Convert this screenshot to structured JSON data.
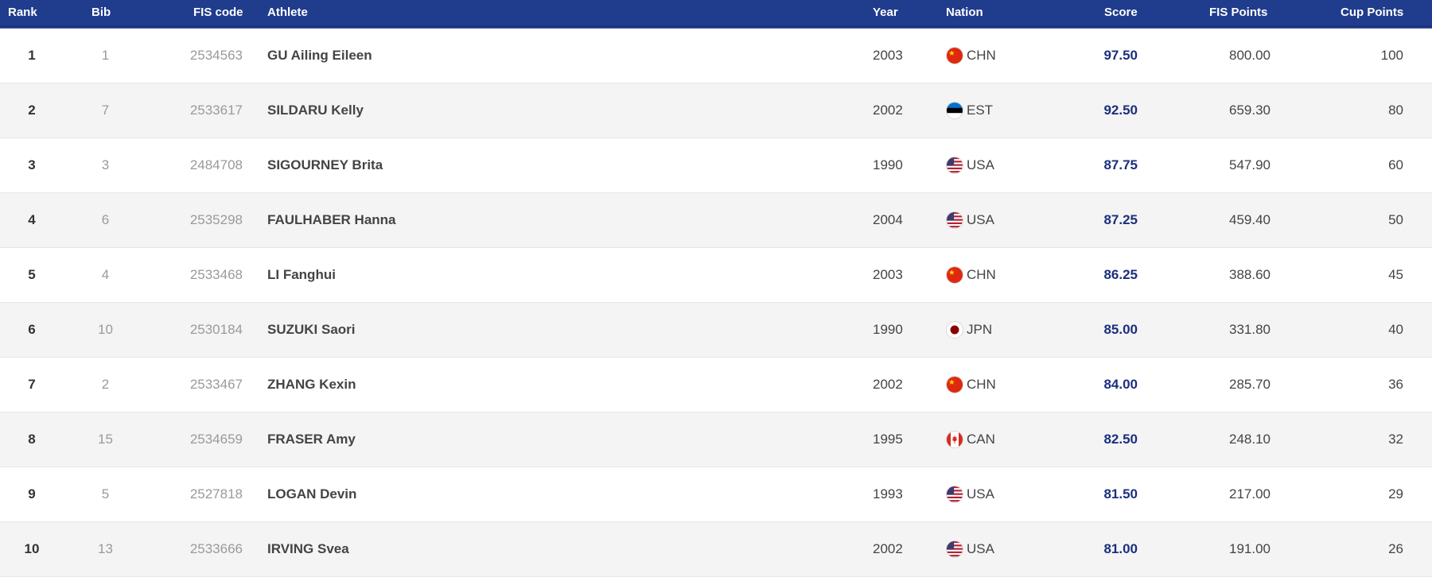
{
  "columns": {
    "rank": "Rank",
    "bib": "Bib",
    "fis_code": "FIS code",
    "athlete": "Athlete",
    "year": "Year",
    "nation": "Nation",
    "score": "Score",
    "fis_points": "FIS Points",
    "cup_points": "Cup Points"
  },
  "rows": [
    {
      "rank": "1",
      "bib": "1",
      "fis_code": "2534563",
      "athlete": "GU Ailing Eileen",
      "year": "2003",
      "nation": "CHN",
      "flag_icon": "china-flag-icon",
      "score": "97.50",
      "fis_points": "800.00",
      "cup_points": "100"
    },
    {
      "rank": "2",
      "bib": "7",
      "fis_code": "2533617",
      "athlete": "SILDARU Kelly",
      "year": "2002",
      "nation": "EST",
      "flag_icon": "estonia-flag-icon",
      "score": "92.50",
      "fis_points": "659.30",
      "cup_points": "80"
    },
    {
      "rank": "3",
      "bib": "3",
      "fis_code": "2484708",
      "athlete": "SIGOURNEY Brita",
      "year": "1990",
      "nation": "USA",
      "flag_icon": "usa-flag-icon",
      "score": "87.75",
      "fis_points": "547.90",
      "cup_points": "60"
    },
    {
      "rank": "4",
      "bib": "6",
      "fis_code": "2535298",
      "athlete": "FAULHABER Hanna",
      "year": "2004",
      "nation": "USA",
      "flag_icon": "usa-flag-icon",
      "score": "87.25",
      "fis_points": "459.40",
      "cup_points": "50"
    },
    {
      "rank": "5",
      "bib": "4",
      "fis_code": "2533468",
      "athlete": "LI Fanghui",
      "year": "2003",
      "nation": "CHN",
      "flag_icon": "china-flag-icon",
      "score": "86.25",
      "fis_points": "388.60",
      "cup_points": "45"
    },
    {
      "rank": "6",
      "bib": "10",
      "fis_code": "2530184",
      "athlete": "SUZUKI Saori",
      "year": "1990",
      "nation": "JPN",
      "flag_icon": "japan-flag-icon",
      "score": "85.00",
      "fis_points": "331.80",
      "cup_points": "40"
    },
    {
      "rank": "7",
      "bib": "2",
      "fis_code": "2533467",
      "athlete": "ZHANG Kexin",
      "year": "2002",
      "nation": "CHN",
      "flag_icon": "china-flag-icon",
      "score": "84.00",
      "fis_points": "285.70",
      "cup_points": "36"
    },
    {
      "rank": "8",
      "bib": "15",
      "fis_code": "2534659",
      "athlete": "FRASER Amy",
      "year": "1995",
      "nation": "CAN",
      "flag_icon": "canada-flag-icon",
      "score": "82.50",
      "fis_points": "248.10",
      "cup_points": "32"
    },
    {
      "rank": "9",
      "bib": "5",
      "fis_code": "2527818",
      "athlete": "LOGAN Devin",
      "year": "1993",
      "nation": "USA",
      "flag_icon": "usa-flag-icon",
      "score": "81.50",
      "fis_points": "217.00",
      "cup_points": "29"
    },
    {
      "rank": "10",
      "bib": "13",
      "fis_code": "2533666",
      "athlete": "IRVING Svea",
      "year": "2002",
      "nation": "USA",
      "flag_icon": "usa-flag-icon",
      "score": "81.00",
      "fis_points": "191.00",
      "cup_points": "26"
    }
  ],
  "colors": {
    "header_bg": "#203c8c",
    "score_text": "#1b2f7d",
    "row_alt_bg": "#f4f4f4"
  }
}
